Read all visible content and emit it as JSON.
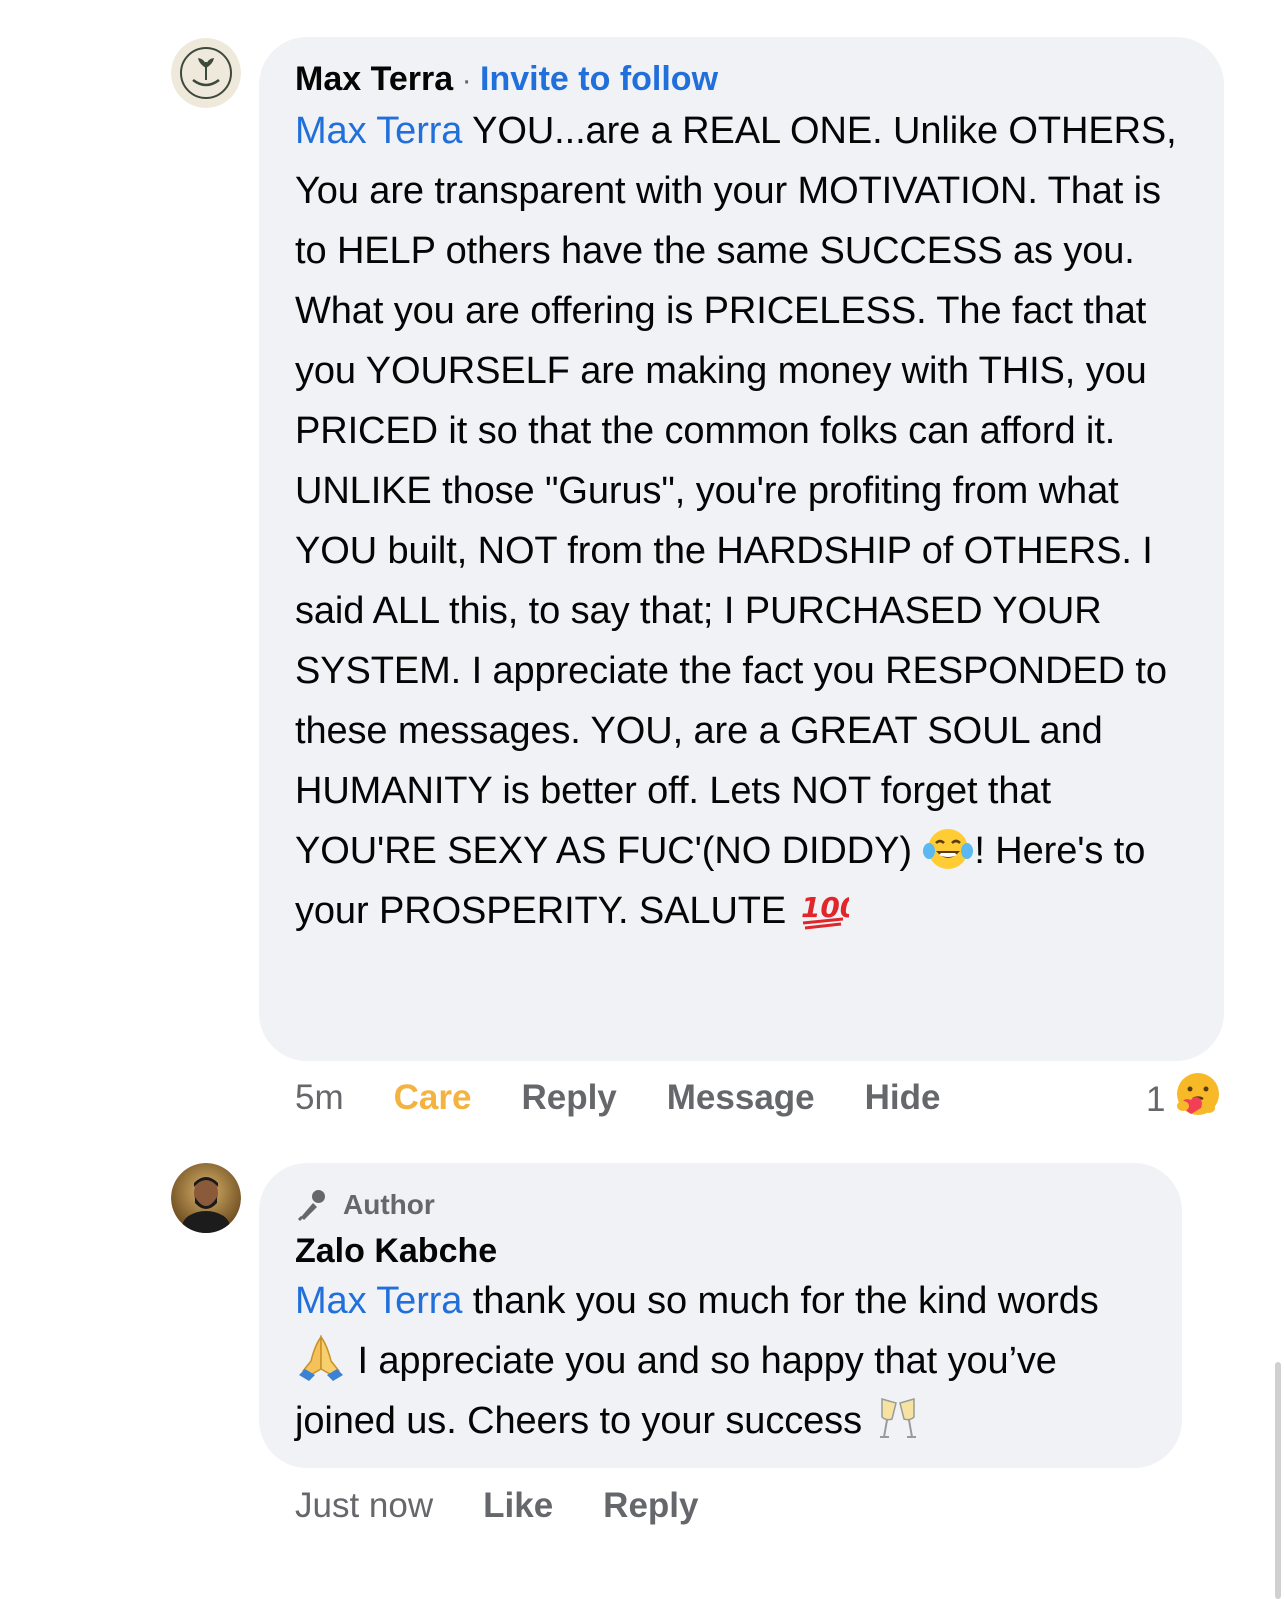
{
  "comments": [
    {
      "author": "Max Terra",
      "separator": "·",
      "follow_label": "Invite to follow",
      "mention": "Max Terra",
      "text_1": " YOU...are a REAL ONE. Unlike OTHERS, You are transparent with your MOTIVATION. That is to HELP others have the same SUCCESS as you. What you are offering is PRICELESS. The fact that you YOURSELF are making money with THIS, you PRICED it so that the common folks can afford it. UNLIKE those \"Gurus\", you're profiting from what YOU built, NOT from the HARDSHIP of OTHERS. I said ALL this, to say that; I PURCHASED YOUR SYSTEM. I appreciate the fact you RESPONDED to these messages. YOU, are a GREAT SOUL and HUMANITY is better off. Lets NOT forget that YOU'RE SEXY AS FUC'(NO DIDDY) ",
      "emoji_1": "laughing-crying-emoji",
      "text_2": "! Here's to your PROSPERITY. SALUTE ",
      "emoji_2": "hundred-points-emoji",
      "time": "5m",
      "reaction_label": "Care",
      "reply_label": "Reply",
      "message_label": "Message",
      "hide_label": "Hide",
      "reaction_count": "1",
      "reaction_icon": "care-reaction-icon"
    },
    {
      "badge": "Author",
      "badge_icon": "microphone-icon",
      "author": "Zalo Kabche",
      "mention": "Max Terra",
      "text_1": " thank you so much for the kind words ",
      "emoji_1": "folded-hands-emoji",
      "text_2": " I appreciate you and so happy that you’ve joined us. Cheers to your success ",
      "emoji_2": "clinking-glasses-emoji",
      "time": "Just now",
      "like_label": "Like",
      "reply_label": "Reply"
    }
  ],
  "colors": {
    "bubble": "#f0f2f5",
    "link": "#216fdb",
    "care": "#f4b23f",
    "meta": "#65676b"
  }
}
